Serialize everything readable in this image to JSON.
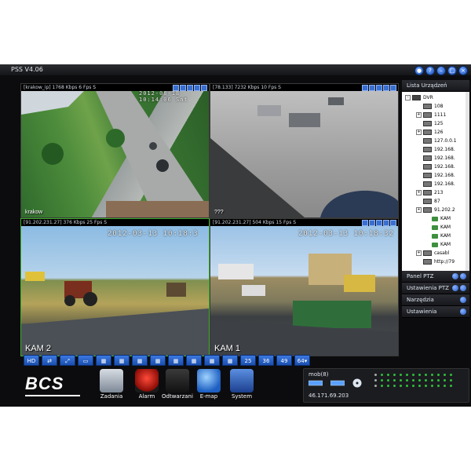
{
  "window": {
    "title": "PSS  V4.06"
  },
  "cameras": [
    {
      "header": "[krakow_ip]  1768 Kbps 6 Fps S",
      "timestamp": "2012-08-18  10:14:06 Sat",
      "label": "krakow"
    },
    {
      "header": "[78.133]  7232 Kbps 10 Fps S",
      "timestamp": "",
      "label": "???"
    },
    {
      "header": "[91.202.231.27]  376 Kbps 25 Fps S",
      "timestamp": "2012-03-13  10:18:3",
      "label": "KAM 2"
    },
    {
      "header": "[91.202.231.27]  504 Kbps 15 Fps S",
      "timestamp": "2012-03-13  10:18:32",
      "label": "KAM 1"
    }
  ],
  "toolbar": {
    "hd": "HD",
    "counts": [
      "25",
      "36",
      "49",
      "64▾"
    ]
  },
  "right_panel": {
    "device_list": "Lista Urządzeń",
    "tree": [
      {
        "label": "DVR",
        "kind": "root"
      },
      {
        "label": "108",
        "kind": "dev"
      },
      {
        "label": "1111",
        "kind": "devexp"
      },
      {
        "label": "125",
        "kind": "dev"
      },
      {
        "label": "126",
        "kind": "devexp"
      },
      {
        "label": "127.0.0.1",
        "kind": "dev"
      },
      {
        "label": "192.168.",
        "kind": "dev"
      },
      {
        "label": "192.168.",
        "kind": "dev"
      },
      {
        "label": "192.168.",
        "kind": "dev"
      },
      {
        "label": "192.168.",
        "kind": "dev"
      },
      {
        "label": "192.168.",
        "kind": "dev"
      },
      {
        "label": "213",
        "kind": "devexp"
      },
      {
        "label": "87",
        "kind": "dev"
      },
      {
        "label": "91.202.2",
        "kind": "devexp"
      },
      {
        "label": "KAM",
        "kind": "cam"
      },
      {
        "label": "KAM",
        "kind": "cam"
      },
      {
        "label": "KAM",
        "kind": "cam"
      },
      {
        "label": "KAM",
        "kind": "cam"
      },
      {
        "label": "casabl",
        "kind": "devexp"
      },
      {
        "label": "http://79",
        "kind": "dev"
      }
    ],
    "panels": [
      "Panel PTZ",
      "Ustawienia PTZ",
      "Narzędzia",
      "Ustawienia"
    ]
  },
  "bottom": {
    "logo": "BCS",
    "menu": [
      {
        "label": "Zadania",
        "icon": "camera-icon"
      },
      {
        "label": "Alarm",
        "icon": "alarm-siren-icon"
      },
      {
        "label": "Odtwarzanie",
        "icon": "clapperboard-icon"
      },
      {
        "label": "E-map",
        "icon": "globe-icon"
      },
      {
        "label": "System",
        "icon": "system-settings-icon"
      }
    ],
    "status_user": "mob(8)",
    "status_ip": "46.171.69.203"
  }
}
